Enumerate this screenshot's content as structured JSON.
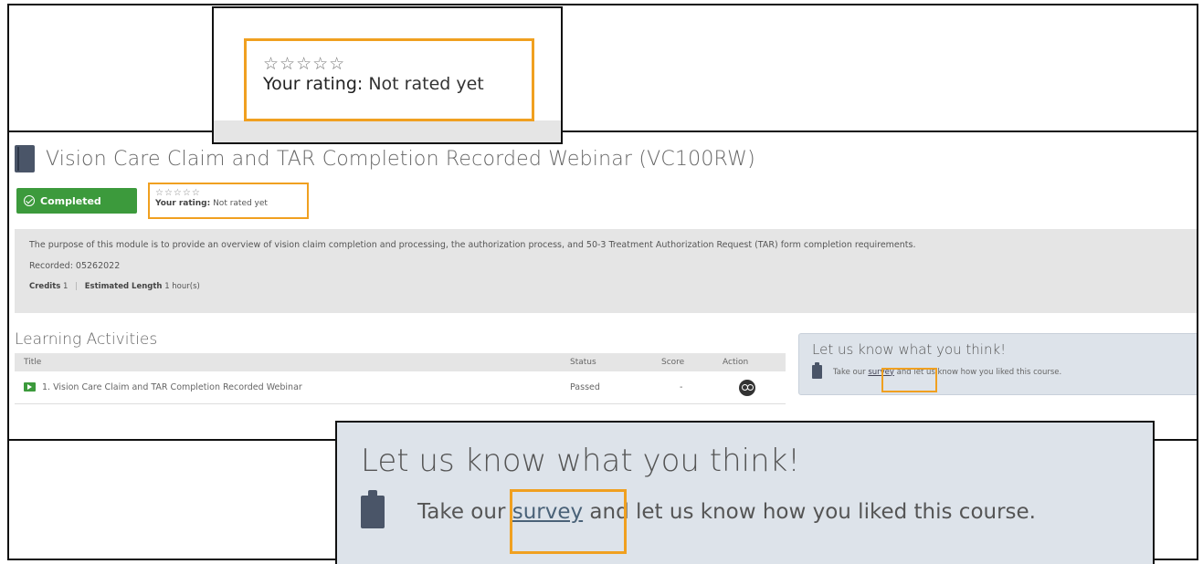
{
  "course": {
    "title": "Vision Care Claim and TAR Completion Recorded Webinar (VC100RW)",
    "status_label": "Completed",
    "description": "The purpose of this module is to provide an overview of vision claim completion and processing, the authorization process, and 50-3 Treatment Authorization Request (TAR) form completion requirements.",
    "recorded": "Recorded: 05262022",
    "credits_label": "Credits",
    "credits_value": "1",
    "length_label": "Estimated Length",
    "length_value": "1 hour(s)"
  },
  "rating": {
    "stars": "☆☆☆☆☆",
    "label": "Your rating:",
    "value": "Not rated yet",
    "value_full": " Not rated yet"
  },
  "learning_activities": {
    "title": "Learning Activities",
    "columns": [
      "Title",
      "Status",
      "Score",
      "Action"
    ],
    "rows": [
      {
        "title": "1. Vision Care Claim and TAR Completion Recorded Webinar",
        "status": "Passed",
        "score": "-"
      }
    ]
  },
  "feedback": {
    "heading": "Let us know what you think!",
    "text_before": "Take our ",
    "link": "survey",
    "text_after": " and let us know how you liked this course."
  },
  "colors": {
    "highlight": "#f0a020",
    "completed_green": "#3c9a3c",
    "feedback_bg": "#dde3ea"
  }
}
